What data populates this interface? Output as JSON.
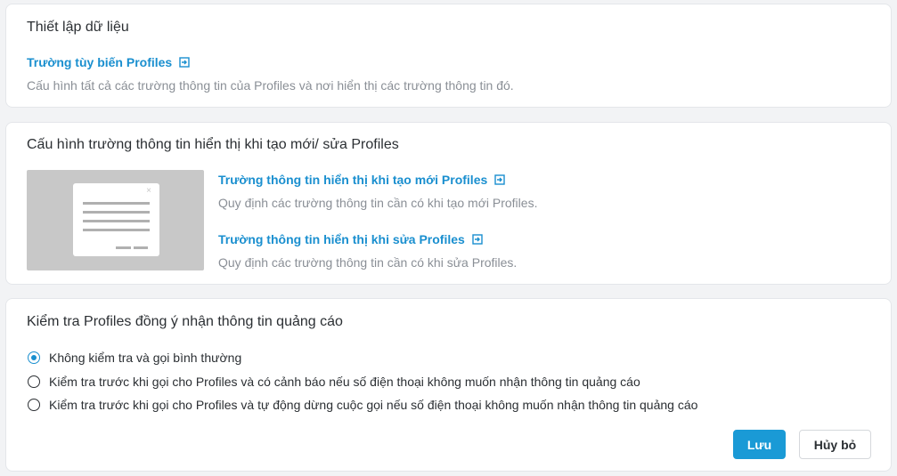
{
  "data_setup": {
    "title": "Thiết lập dữ liệu",
    "custom_fields_link": "Trường tùy biến Profiles",
    "custom_fields_desc": "Cấu hình tất cả các trường thông tin của Profiles và nơi hiển thị các trường thông tin đó."
  },
  "display_config": {
    "title": "Cấu hình trường thông tin hiển thị khi tạo mới/ sửa Profiles",
    "create_link": "Trường thông tin hiển thị khi tạo mới Profiles",
    "create_desc": "Quy định các trường thông tin cần có khi tạo mới Profiles.",
    "edit_link": "Trường thông tin hiển thị khi sửa Profiles",
    "edit_desc": "Quy định các trường thông tin cần có khi sửa Profiles.",
    "illustration_close": "×"
  },
  "ad_consent": {
    "title": "Kiểm tra Profiles đồng ý nhận thông tin quảng cáo",
    "options": [
      {
        "label": "Không kiểm tra và gọi bình thường",
        "selected": true
      },
      {
        "label": "Kiểm tra trước khi gọi cho Profiles và có cảnh báo nếu số điện thoại không muốn nhận thông tin quảng cáo",
        "selected": false
      },
      {
        "label": "Kiểm tra trước khi gọi cho Profiles và tự động dừng cuộc gọi nếu số điện thoại không muốn nhận thông tin quảng cáo",
        "selected": false
      }
    ],
    "save_label": "Lưu",
    "cancel_label": "Hủy bỏ"
  },
  "colors": {
    "accent": "#1a8fcf",
    "primary_button": "#1a9ad6",
    "muted_text": "#8a8f96",
    "background": "#f2f3f5"
  },
  "icons": {
    "external_link": "external-link-icon"
  }
}
